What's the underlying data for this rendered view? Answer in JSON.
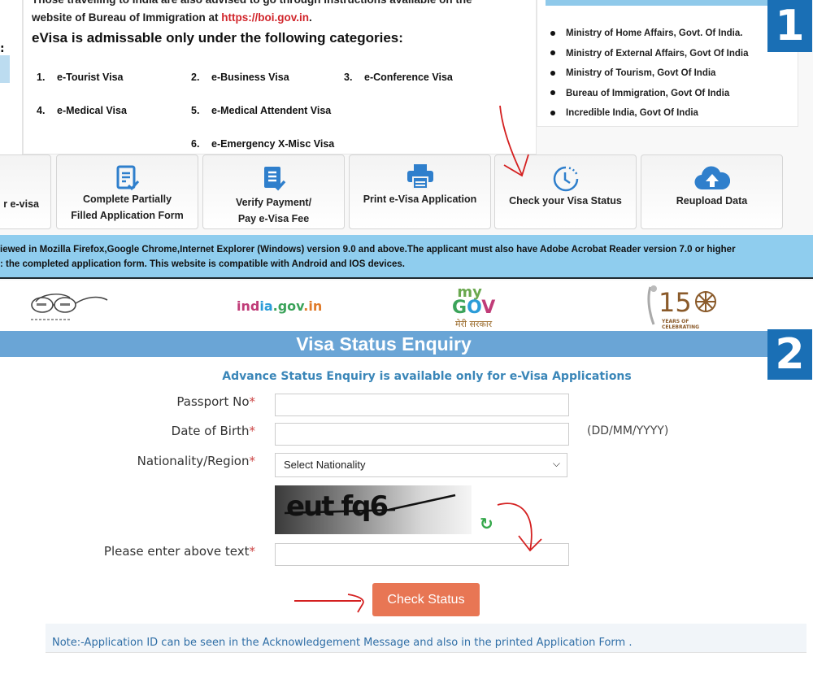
{
  "section1": {
    "badge": "1",
    "intro_line1": "Those travelling to India are also advised to go through instructions available on the",
    "intro_line2_prefix": "website of Bureau of Immigration at ",
    "intro_link": "https://boi.gov.in",
    "intro_line2_suffix": ".",
    "categories_title": "eVisa is admissable only under the following categories:",
    "categories": [
      {
        "num": "1.",
        "label": "e-Tourist Visa"
      },
      {
        "num": "2.",
        "label": "e-Business Visa"
      },
      {
        "num": "3.",
        "label": "e-Conference Visa"
      },
      {
        "num": "4.",
        "label": "e-Medical Visa"
      },
      {
        "num": "5.",
        "label": "e-Medical Attendent Visa"
      },
      {
        "num": "6.",
        "label": "e-Emergency X-Misc Visa"
      }
    ],
    "links": [
      "Ministry of Home Affairs, Govt. Of India.",
      "Ministry of External Affairs, Govt Of India",
      "Ministry of Tourism, Govt Of India",
      "Bureau of Immigration, Govt Of India",
      "Incredible India, Govt Of India"
    ],
    "tiles": [
      {
        "label_line1": "r e-visa",
        "label_line2": "",
        "icon": "none"
      },
      {
        "label_line1": "Complete Partially",
        "label_line2": "Filled Application Form",
        "icon": "document-check-icon"
      },
      {
        "label_line1": "Verify Payment/",
        "label_line2": "Pay e-Visa Fee",
        "icon": "document-check-icon"
      },
      {
        "label_line1": "Print e-Visa Application",
        "label_line2": "",
        "icon": "printer-icon"
      },
      {
        "label_line1": "Check your Visa Status",
        "label_line2": "",
        "icon": "clock-icon"
      },
      {
        "label_line1": "Reupload Data",
        "label_line2": "",
        "icon": "cloud-upload-icon"
      }
    ],
    "compat_line1": "iewed in Mozilla Firefox,Google Chrome,Internet Explorer (Windows) version 9.0 and above.The applicant must also have Adobe Acrobat Reader version 7.0 or higher",
    "compat_line2": ": the completed application form. This website is compatible with Android and IOS devices."
  },
  "section2": {
    "badge": "2",
    "logos": {
      "indiagov": "india.gov.in",
      "mygov_top": "my",
      "mygov_mid": "GOV",
      "mygov_hindi": "मेरी सरकार",
      "gandhi_number": "150",
      "gandhi_caption": "YEARS OF CELEBRATING"
    },
    "title": "Visa Status Enquiry",
    "subtitle": "Advance Status Enquiry is available only for e-Visa Applications",
    "form": {
      "passport_label": "Passport No",
      "passport_value": "",
      "dob_label": "Date of Birth",
      "dob_value": "",
      "dob_hint": "(DD/MM/YYYY)",
      "nationality_label": "Nationality/Region",
      "nationality_selected": "Select Nationality",
      "captcha_text": "eut fq6",
      "captcha_label": "Please enter above text",
      "captcha_value": "",
      "required_mark": "*",
      "submit_label": "Check Status"
    },
    "note": "Note:-Application ID can be seen in the Acknowledgement Message and also in the printed Application Form ."
  },
  "colors": {
    "badge": "#1a6fb5",
    "title_bar": "#6aa5d6",
    "compat_bar": "#8fcdee",
    "submit_button": "#e87654",
    "link_red": "#d1262c",
    "annotation_red": "#d42020"
  }
}
